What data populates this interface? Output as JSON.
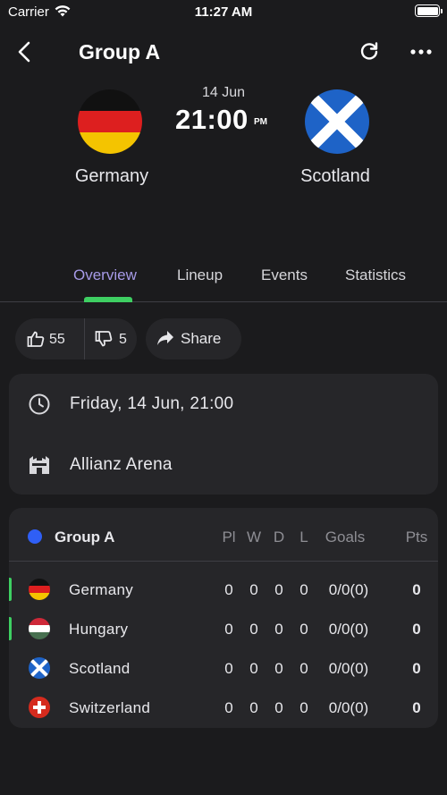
{
  "status_bar": {
    "carrier": "Carrier",
    "time": "11:27 AM"
  },
  "nav": {
    "title": "Group A"
  },
  "match": {
    "home_team": "Germany",
    "away_team": "Scotland",
    "date": "14 Jun",
    "time": "21:00",
    "ampm": "PM"
  },
  "tabs": [
    {
      "label": "Overview",
      "active": true
    },
    {
      "label": "Lineup",
      "active": false
    },
    {
      "label": "Events",
      "active": false
    },
    {
      "label": "Statistics",
      "active": false
    }
  ],
  "actions": {
    "likes": "55",
    "dislikes": "5",
    "share": "Share"
  },
  "info": {
    "datetime": "Friday, 14 Jun, 21:00",
    "venue": "Allianz Arena"
  },
  "standings": {
    "group": "Group A",
    "columns": {
      "played": "Pl",
      "won": "W",
      "drawn": "D",
      "lost": "L",
      "goals": "Goals",
      "points": "Pts"
    },
    "rows": [
      {
        "team": "Germany",
        "pl": "0",
        "w": "0",
        "d": "0",
        "l": "0",
        "goals": "0/0(0)",
        "pts": "0",
        "flag": "germany-flag"
      },
      {
        "team": "Hungary",
        "pl": "0",
        "w": "0",
        "d": "0",
        "l": "0",
        "goals": "0/0(0)",
        "pts": "0",
        "flag": "hungary-flag"
      },
      {
        "team": "Scotland",
        "pl": "0",
        "w": "0",
        "d": "0",
        "l": "0",
        "goals": "0/0(0)",
        "pts": "0",
        "flag": "scotland-flag"
      },
      {
        "team": "Switzerland",
        "pl": "0",
        "w": "0",
        "d": "0",
        "l": "0",
        "goals": "0/0(0)",
        "pts": "0",
        "flag": "switzerland-flag"
      }
    ]
  },
  "colors": {
    "background": "#1b1b1d",
    "card": "#262629",
    "active_tab": "#a69ae6",
    "indicator": "#3ecf62",
    "group_dot": "#2f5ff6"
  }
}
